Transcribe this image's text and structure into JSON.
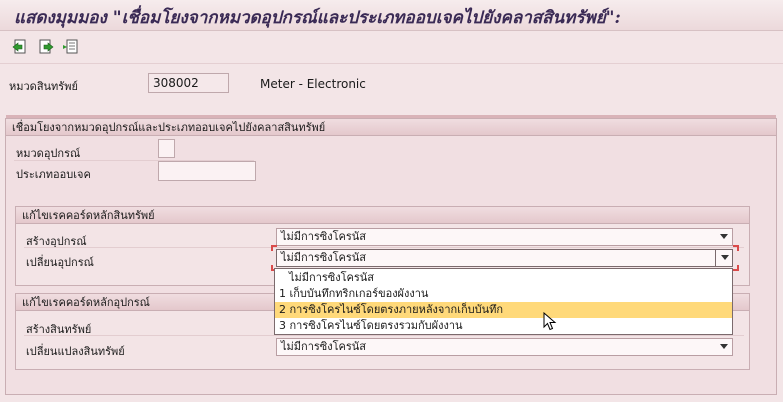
{
  "title": "แสดงมุมมอง \"เชื่อมโยงจากหมวดอุปกรณ์และประเภทออบเจคไปยังคลาสสินทรัพย์\":",
  "toolbar": {
    "buttons": [
      "back-icon",
      "forward-icon",
      "export-icon"
    ]
  },
  "header": {
    "asset_class_label": "หมวดสินทรัพย์",
    "asset_class_value": "308002",
    "asset_class_desc": "Meter - Electronic"
  },
  "link_group": {
    "title": "เชื่อมโยงจากหมวดอุปกรณ์และประเภทออบเจคไปยังคลาสสินทรัพย์",
    "equipment_category_label": "หมวดอุปกรณ์",
    "equipment_category_value": "",
    "object_type_label": "ประเภทออบเจค",
    "object_type_value": ""
  },
  "asset_master_group": {
    "title": "แก้ไขเรคคอร์ดหลักสินทรัพย์",
    "create_equipment_label": "สร้างอุปกรณ์",
    "create_equipment_value": "ไม่มีการซิงโครนัส",
    "change_equipment_label": "เปลี่ยนอุปกรณ์",
    "change_equipment_value": "ไม่มีการซิงโครนัส"
  },
  "equipment_master_group": {
    "title": "แก้ไขเรคคอร์ดหลักอุปกรณ์",
    "create_asset_label": "สร้างสินทรัพย์",
    "create_asset_value": "",
    "change_asset_label": "เปลี่ยนแปลงสินทรัพย์",
    "change_asset_value": "ไม่มีการซิงโครนัส"
  },
  "dropdown_list": {
    "options": [
      "ไม่มีการซิงโครนัส",
      "1 เก็บบันทึกทริกเกอร์ของผังงาน",
      "2 การซิงโครไนซ์โดยตรงภายหลังจากเก็บบันทึก",
      "3 การซิงโครไนซ์โดยตรงรวมกับผังงาน"
    ],
    "highlighted_index": 2
  },
  "colors": {
    "highlight": "#ffd97a",
    "title": "#3a2a55",
    "background": "#f3e5e7"
  }
}
